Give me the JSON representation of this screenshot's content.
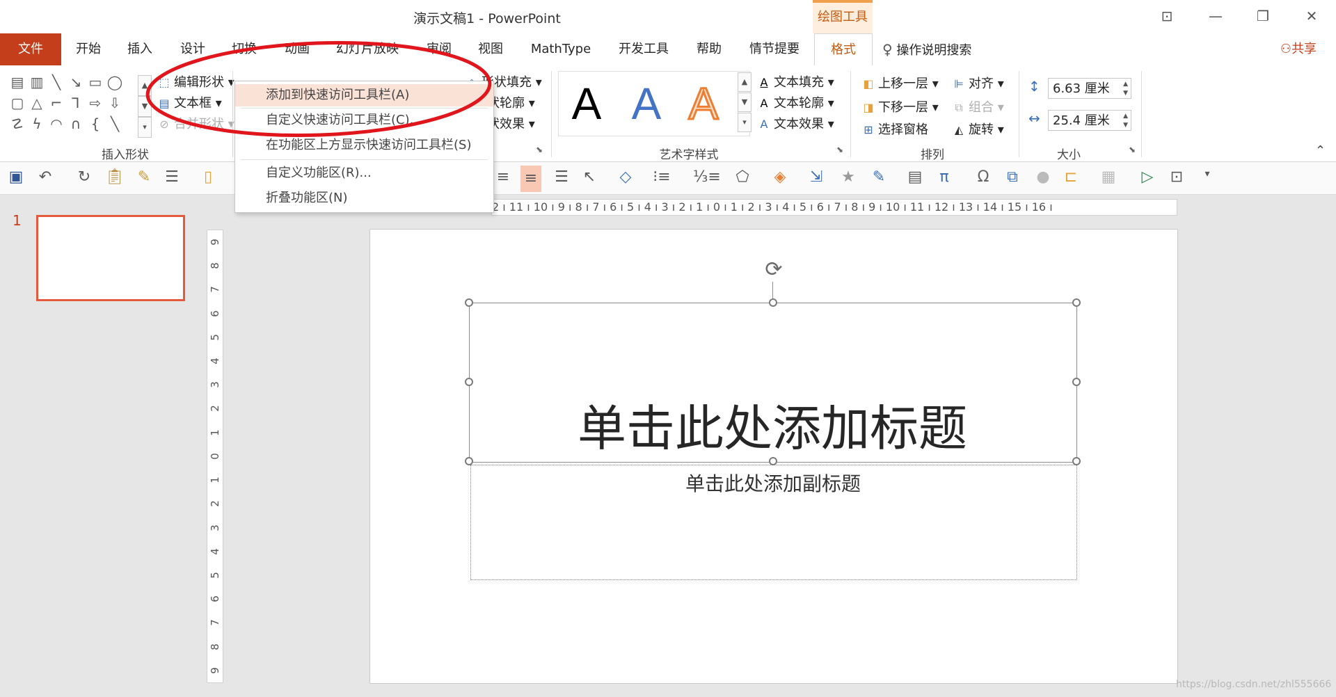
{
  "window": {
    "title": "演示文稿1  -  PowerPoint",
    "context_tab": "绘图工具",
    "buttons": [
      "⊡",
      "—",
      "❐",
      "✕"
    ]
  },
  "tabs": [
    {
      "label": "文件"
    },
    {
      "label": "开始"
    },
    {
      "label": "插入"
    },
    {
      "label": "设计"
    },
    {
      "label": "切换"
    },
    {
      "label": "动画"
    },
    {
      "label": "幻灯片放映"
    },
    {
      "label": "审阅"
    },
    {
      "label": "视图"
    },
    {
      "label": "MathType"
    },
    {
      "label": "开发工具"
    },
    {
      "label": "帮助"
    },
    {
      "label": "情节提要"
    },
    {
      "label": "格式"
    }
  ],
  "tell_me": "操作说明搜索",
  "share": "共享",
  "ribbon": {
    "groups": {
      "insert_shapes": "插入形状",
      "wordart_styles": "艺术字样式",
      "arrange": "排列",
      "size": "大小"
    },
    "edit_shape": "编辑形状",
    "text_box": "文本框",
    "merge_shapes": "合并形状",
    "shape_fill": "形状填充",
    "shape_outline": "状轮廓",
    "shape_effects": "状效果",
    "text_fill": "文本填充",
    "text_outline": "文本轮廓",
    "text_effects": "文本效果",
    "bring_forward": "上移一层",
    "send_backward": "下移一层",
    "selection_pane": "选择窗格",
    "align": "对齐",
    "group": "组合",
    "rotate": "旋转",
    "height": "6.63 厘米",
    "width": "25.4 厘米",
    "wordart_letter": "A"
  },
  "context_menu": {
    "items": [
      "添加到快速访问工具栏(A)",
      "自定义快速访问工具栏(C)...",
      "在功能区上方显示快速访问工具栏(S)",
      "自定义功能区(R)...",
      "折叠功能区(N)"
    ]
  },
  "ruler": {
    "horizontal": "2 ı 11 ı 10 ı 9 ı 8 ı 7 ı 6 ı 5 ı 4 ı 3 ı 2 ı 1 ı 0 ı 1 ı 2 ı 3 ı 4 ı 5 ı 6 ı 7 ı 8 ı 9 ı 10 ı 11 ı 12 ı 13 ı 14 ı 15 ı 16 ı",
    "vertical": [
      "9",
      "8",
      "7",
      "6",
      "5",
      "4",
      "3",
      "2",
      "1",
      "0",
      "1",
      "2",
      "3",
      "4",
      "5",
      "6",
      "7",
      "8",
      "9"
    ]
  },
  "slide_panel": {
    "number": "1"
  },
  "slide": {
    "title": "单击此处添加标题",
    "subtitle": "单击此处添加副标题"
  },
  "watermark": "https://blog.csdn.net/zhl555666",
  "colors": {
    "file_tab": "#c43e1c",
    "context_accent": "#c55a11",
    "annotation": "#e0161c",
    "wordart_blue": "#4472c4",
    "wordart_orange": "#ed7d31"
  }
}
